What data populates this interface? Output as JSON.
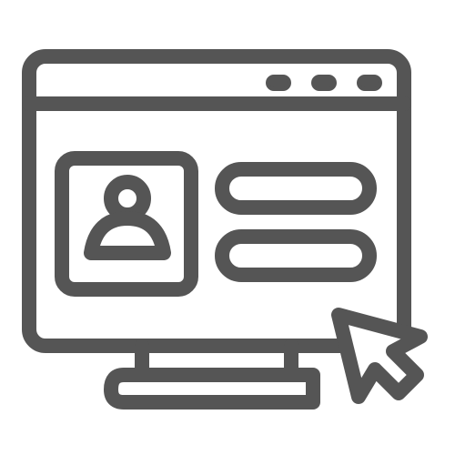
{
  "icon": {
    "name": "computer-user-profile-icon",
    "stroke_color": "#555555",
    "background_color": "#ffffff",
    "parts": [
      "monitor-icon",
      "window-dot-icon",
      "avatar-icon",
      "text-line-icon",
      "cursor-arrow-icon"
    ]
  }
}
